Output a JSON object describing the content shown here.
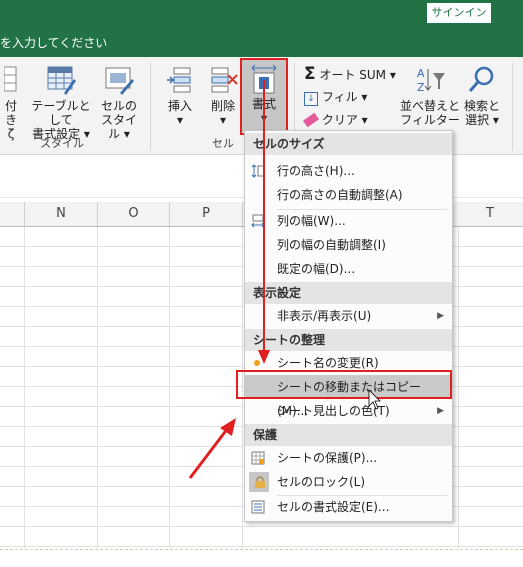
{
  "titlebar": {
    "signin_label": "サインイン"
  },
  "tellme": {
    "placeholder_text": "を入力してください"
  },
  "ribbon": {
    "groups": {
      "style": "スタイル",
      "cells": "セル"
    },
    "conditional_fragment": "付き",
    "conditional_fragment2": "ζ",
    "table_format": {
      "line1": "テーブルとして",
      "line2": "書式設定"
    },
    "cell_style": {
      "line1": "セルの",
      "line2": "スタイル"
    },
    "insert": "挿入",
    "delete": "削除",
    "format": "書式",
    "autosum": "オート SUM",
    "fill": "フィル",
    "clear": "クリア",
    "sort_filter": {
      "line1": "並べ替えと",
      "line2": "フィルター"
    },
    "find_select": {
      "line1": "検索と",
      "line2": "選択"
    }
  },
  "columns": [
    "N",
    "O",
    "P",
    "T"
  ],
  "menu": {
    "section_cell_size": "セルのサイズ",
    "row_height": "行の高さ(H)...",
    "row_height_auto": "行の高さの自動調整(A)",
    "col_width": "列の幅(W)...",
    "col_width_auto": "列の幅の自動調整(I)",
    "default_width": "既定の幅(D)...",
    "section_visibility": "表示設定",
    "hide_unhide": "非表示/再表示(U)",
    "section_organize": "シートの整理",
    "rename_sheet": "シート名の変更(R)",
    "move_copy": "シートの移動またはコピー(M)...",
    "tab_color": "シート見出しの色(T)",
    "section_protect": "保護",
    "protect_sheet": "シートの保護(P)...",
    "lock_cell": "セルのロック(L)",
    "format_cells": "セルの書式設定(E)..."
  },
  "colors": {
    "excel_green": "#217346",
    "annotation_red": "#e02020",
    "highlight": "#c9c9c9"
  }
}
